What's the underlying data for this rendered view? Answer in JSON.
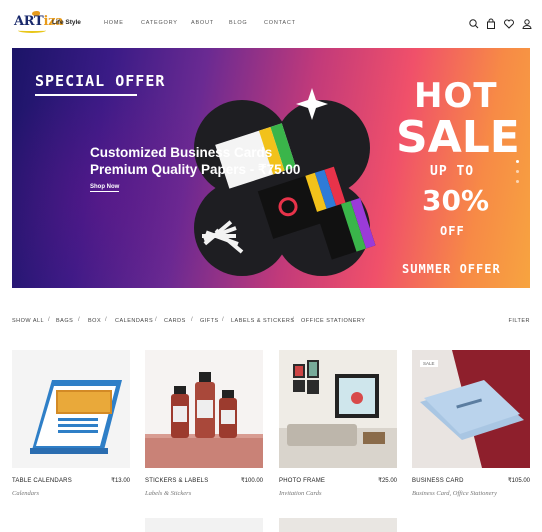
{
  "brand": {
    "logo_text": "ART",
    "logo_text_accent": "iza",
    "tagline": "Life Style"
  },
  "nav": [
    "HOME",
    "CATEGORY",
    "ABOUT",
    "BLOG",
    "CONTACT"
  ],
  "header_icons": [
    "search-icon",
    "bag-icon",
    "heart-icon",
    "user-icon"
  ],
  "banner": {
    "special_offer": "SPECIAL OFFER",
    "title_line1": "Customized Business Cards",
    "title_line2": "Premium Quality Papers - ₹75.00",
    "cta": "Shop Now",
    "hot": "HOT",
    "sale": "SALE",
    "up_to": "UP TO",
    "percent": "30%",
    "off": "OFF",
    "summer": "SUMMER OFFER",
    "colors": {
      "from": "#1b1467",
      "mid": "#c23a7a",
      "to": "#f7a440"
    }
  },
  "filters": {
    "items": [
      "SHOW ALL",
      "BAGS",
      "BOX",
      "CALENDARS",
      "CARDS",
      "GIFTS",
      "LABELS & STICKERS",
      "OFFICE STATIONERY"
    ],
    "filter_button": "FILTER"
  },
  "products": [
    {
      "name": "TABLE CALENDARS",
      "price": "₹13.00",
      "category": "Calendars",
      "badge": ""
    },
    {
      "name": "STICKERS & LABELS",
      "price": "₹100.00",
      "category": "Labels & Stickers",
      "badge": ""
    },
    {
      "name": "PHOTO FRAME",
      "price": "₹25.00",
      "category": "Invitation Cards",
      "badge": ""
    },
    {
      "name": "BUSINESS CARD",
      "price": "₹105.00",
      "category": "Business Card, Office Stationery",
      "badge": "SALE"
    }
  ]
}
